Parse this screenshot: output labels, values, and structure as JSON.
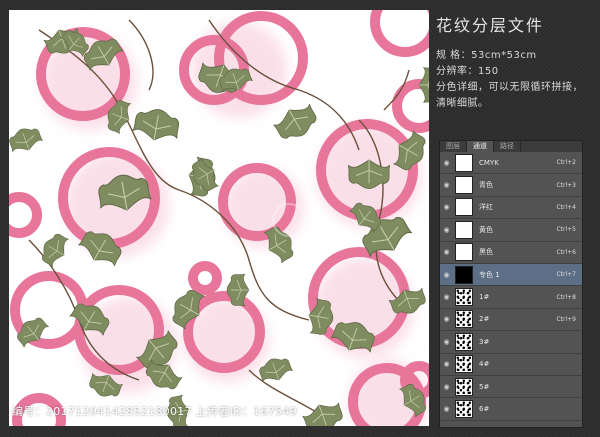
{
  "info": {
    "title": "花纹分层文件",
    "spec_line": "规  格：53cm*53cm",
    "resolution_line": "分辨率：150",
    "desc_line1": "分色详细，可以无限循环拼接，",
    "desc_line2": "清晰细腻。"
  },
  "panel": {
    "tabs": [
      "图层",
      "通道",
      "路径"
    ],
    "active_tab": "通道",
    "channels": [
      {
        "name": "CMYK",
        "shortcut": "Ctrl+2",
        "thumb": "white"
      },
      {
        "name": "青色",
        "shortcut": "Ctrl+3",
        "thumb": "white"
      },
      {
        "name": "洋红",
        "shortcut": "Ctrl+4",
        "thumb": "white"
      },
      {
        "name": "黄色",
        "shortcut": "Ctrl+5",
        "thumb": "white"
      },
      {
        "name": "黑色",
        "shortcut": "Ctrl+6",
        "thumb": "white"
      },
      {
        "name": "专色 1",
        "shortcut": "Ctrl+7",
        "thumb": "black",
        "selected": true
      },
      {
        "name": "1#",
        "shortcut": "Ctrl+8",
        "thumb": "texture"
      },
      {
        "name": "2#",
        "shortcut": "Ctrl+9",
        "thumb": "texture"
      },
      {
        "name": "3#",
        "shortcut": "",
        "thumb": "texture"
      },
      {
        "name": "4#",
        "shortcut": "",
        "thumb": "texture"
      },
      {
        "name": "5#",
        "shortcut": "",
        "thumb": "texture"
      },
      {
        "name": "6#",
        "shortcut": "",
        "thumb": "texture"
      }
    ]
  },
  "footer": {
    "id_text": "编号：20171204142852180017 上传者ID：167549"
  },
  "colors": {
    "ring": "#e8769b",
    "leaf": "#7d8a5e",
    "selected_row": "#5d6f86"
  }
}
